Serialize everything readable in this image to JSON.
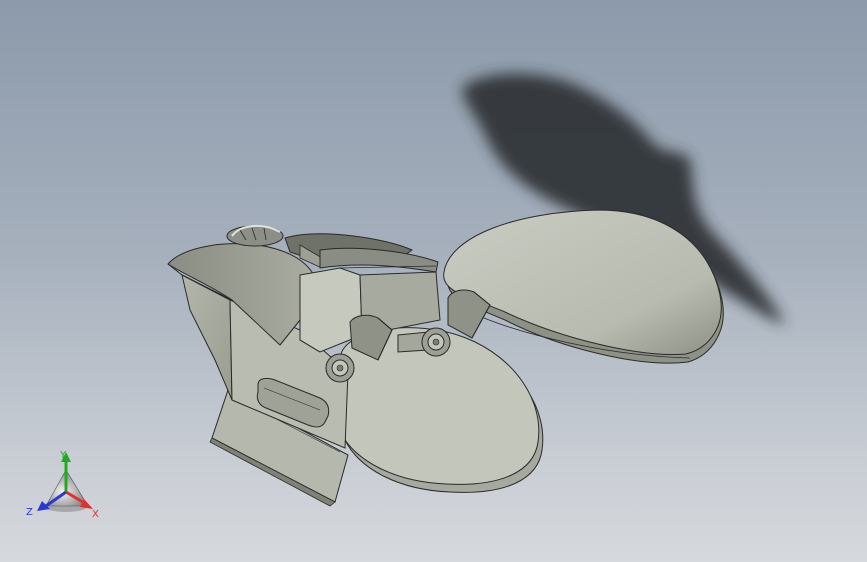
{
  "viewport": {
    "background_top": "#8c9aab",
    "background_bottom": "#d6d9dd"
  },
  "model": {
    "icon": "3d-mouse-model",
    "body_color": "#b9bcb0",
    "edge_color": "#2a2a2a",
    "shadow_color": "#2f3236"
  },
  "triad": {
    "x_label": "X",
    "y_label": "Y",
    "z_label": "Z",
    "x_color": "#e03030",
    "y_color": "#22aa22",
    "z_color": "#2a3ad0"
  }
}
